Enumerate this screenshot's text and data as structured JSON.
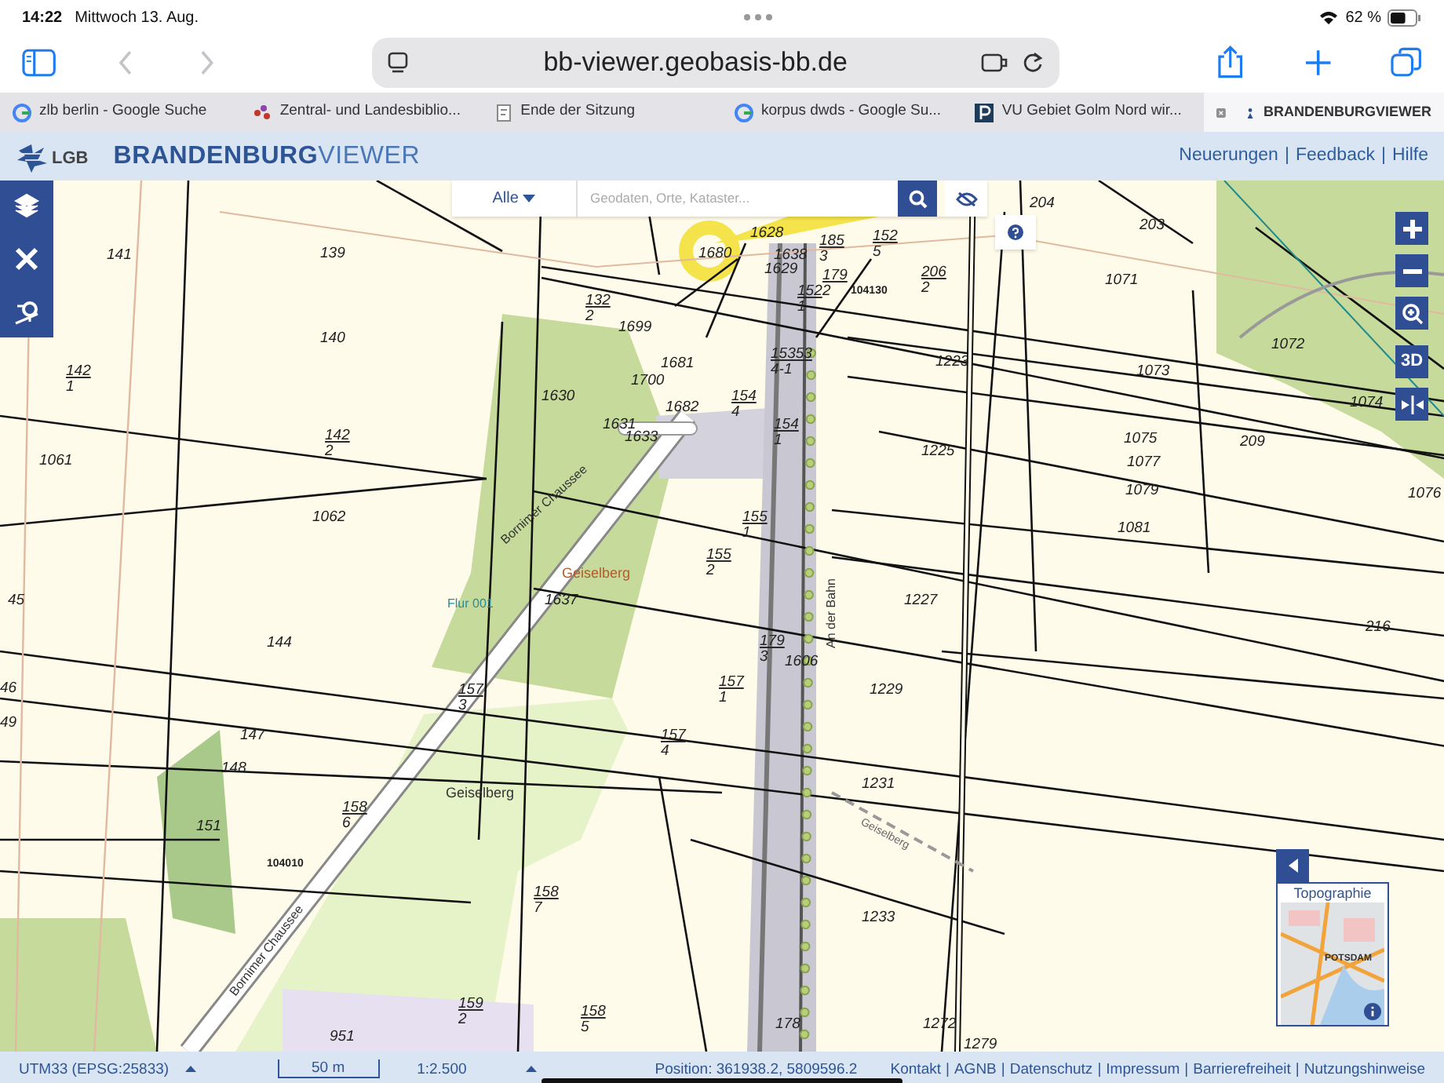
{
  "device_status": {
    "time": "14:22",
    "date": "Mittwoch 13. Aug.",
    "battery": "62 %"
  },
  "browser": {
    "url": "bb-viewer.geobasis-bb.de"
  },
  "tabs": [
    {
      "label": "zlb berlin - Google Suche",
      "kind": "google",
      "selected": false
    },
    {
      "label": "Zentral- und Landesbiblio...",
      "kind": "library",
      "selected": false
    },
    {
      "label": "Ende der Sitzung",
      "kind": "document",
      "selected": false
    },
    {
      "label": "korpus dwds - Google Su...",
      "kind": "google",
      "selected": false
    },
    {
      "label": "VU Gebiet Golm Nord wir...",
      "kind": "letter",
      "selected": false
    },
    {
      "label": "BRANDENBURGVIEWER",
      "kind": "viewer",
      "selected": true
    }
  ],
  "app_header": {
    "logo": "LGB",
    "title_bold": "BRANDENBURG",
    "title_light": "VIEWER",
    "separator": "|",
    "links": [
      "Neuerungen",
      "Feedback",
      "Hilfe"
    ]
  },
  "search": {
    "category": "Alle",
    "placeholder": "Geodaten, Orte, Kataster..."
  },
  "map_controls": {
    "button_3d": "3D"
  },
  "map_labels": [
    {
      "kind": "parcel",
      "text": "204"
    },
    {
      "kind": "parcel",
      "text": "203"
    },
    {
      "kind": "parcel",
      "text": "1628"
    },
    {
      "kind": "parcel",
      "text": "141"
    },
    {
      "kind": "parcel",
      "text": "139"
    },
    {
      "kind": "parcel",
      "text": "1680"
    },
    {
      "kind": "parcel",
      "text": "1638"
    },
    {
      "kind": "parcel",
      "text": "185",
      "sub": "3"
    },
    {
      "kind": "parcel",
      "text": "152",
      "sub": "5"
    },
    {
      "kind": "parcel",
      "text": "1629"
    },
    {
      "kind": "parcel",
      "text": "179",
      "sub": "2"
    },
    {
      "kind": "parcel",
      "text": "206",
      "sub": "2"
    },
    {
      "kind": "parcel",
      "text": "1071"
    },
    {
      "kind": "parcel",
      "text": "152",
      "sub": "1"
    },
    {
      "kind": "point",
      "text": "104130"
    },
    {
      "kind": "parcel",
      "text": "132",
      "sub": "2"
    },
    {
      "kind": "parcel",
      "text": "1699"
    },
    {
      "kind": "parcel",
      "text": "140"
    },
    {
      "kind": "parcel",
      "text": "1072"
    },
    {
      "kind": "parcel",
      "text": "1681"
    },
    {
      "kind": "parcel",
      "text": "15353",
      "sub": "4-1"
    },
    {
      "kind": "parcel",
      "text": "1223"
    },
    {
      "kind": "parcel",
      "text": "142",
      "sub": "1"
    },
    {
      "kind": "parcel",
      "text": "1073"
    },
    {
      "kind": "parcel",
      "text": "1700"
    },
    {
      "kind": "parcel",
      "text": "1630"
    },
    {
      "kind": "parcel",
      "text": "1682"
    },
    {
      "kind": "parcel",
      "text": "154",
      "sub": "4"
    },
    {
      "kind": "parcel",
      "text": "1074"
    },
    {
      "kind": "parcel",
      "text": "1631"
    },
    {
      "kind": "parcel",
      "text": "154",
      "sub": "1"
    },
    {
      "kind": "parcel",
      "text": "142",
      "sub": "2"
    },
    {
      "kind": "parcel",
      "text": "1633"
    },
    {
      "kind": "parcel",
      "text": "1075"
    },
    {
      "kind": "parcel",
      "text": "209"
    },
    {
      "kind": "parcel",
      "text": "1225"
    },
    {
      "kind": "parcel",
      "text": "1061"
    },
    {
      "kind": "parcel",
      "text": "1077"
    },
    {
      "kind": "parcel",
      "text": "1079"
    },
    {
      "kind": "parcel",
      "text": "1076"
    },
    {
      "kind": "street",
      "text": "Bornimer Chaussee"
    },
    {
      "kind": "parcel",
      "text": "1062"
    },
    {
      "kind": "parcel",
      "text": "155",
      "sub": "1"
    },
    {
      "kind": "parcel",
      "text": "1081"
    },
    {
      "kind": "parcel",
      "text": "155",
      "sub": "2"
    },
    {
      "kind": "place",
      "text": "Geiselberg",
      "accent": true
    },
    {
      "kind": "parcel",
      "text": "45"
    },
    {
      "kind": "flur",
      "text": "Flur 001"
    },
    {
      "kind": "parcel",
      "text": "1637"
    },
    {
      "kind": "street",
      "text": "An der Bahn"
    },
    {
      "kind": "parcel",
      "text": "1227"
    },
    {
      "kind": "parcel",
      "text": "216"
    },
    {
      "kind": "parcel",
      "text": "144"
    },
    {
      "kind": "parcel",
      "text": "179",
      "sub": "3"
    },
    {
      "kind": "parcel",
      "text": "1606"
    },
    {
      "kind": "parcel",
      "text": "46"
    },
    {
      "kind": "parcel",
      "text": "157",
      "sub": "3"
    },
    {
      "kind": "parcel",
      "text": "157",
      "sub": "1"
    },
    {
      "kind": "parcel",
      "text": "1229"
    },
    {
      "kind": "parcel",
      "text": "49"
    },
    {
      "kind": "parcel",
      "text": "147"
    },
    {
      "kind": "parcel",
      "text": "157",
      "sub": "4"
    },
    {
      "kind": "parcel",
      "text": "148"
    },
    {
      "kind": "parcel",
      "text": "1231"
    },
    {
      "kind": "place",
      "text": "Geiselberg",
      "accent": false
    },
    {
      "kind": "parcel",
      "text": "158",
      "sub": "6"
    },
    {
      "kind": "parcel",
      "text": "151"
    },
    {
      "kind": "line",
      "text": "Geiselberg"
    },
    {
      "kind": "point",
      "text": "104010"
    },
    {
      "kind": "parcel",
      "text": "158",
      "sub": "7"
    },
    {
      "kind": "parcel",
      "text": "1233"
    },
    {
      "kind": "street",
      "text": "Bornimer Chaussee"
    },
    {
      "kind": "parcel",
      "text": "159",
      "sub": "2"
    },
    {
      "kind": "parcel",
      "text": "158",
      "sub": "5"
    },
    {
      "kind": "parcel",
      "text": "178"
    },
    {
      "kind": "parcel",
      "text": "1272"
    },
    {
      "kind": "parcel",
      "text": "951"
    },
    {
      "kind": "parcel",
      "text": "1279"
    }
  ],
  "basemap": {
    "title": "Topographie",
    "place": "POTSDAM"
  },
  "footer": {
    "crs": "UTM33 (EPSG:25833)",
    "scale_bar": "50 m",
    "scale": "1:2.500",
    "position": "Position: 361938.2, 5809596.2",
    "separator": "|",
    "links": [
      "Kontakt",
      "AGNB",
      "Datenschutz",
      "Impressum",
      "Barrierefreiheit",
      "Nutzungshinweise"
    ]
  }
}
